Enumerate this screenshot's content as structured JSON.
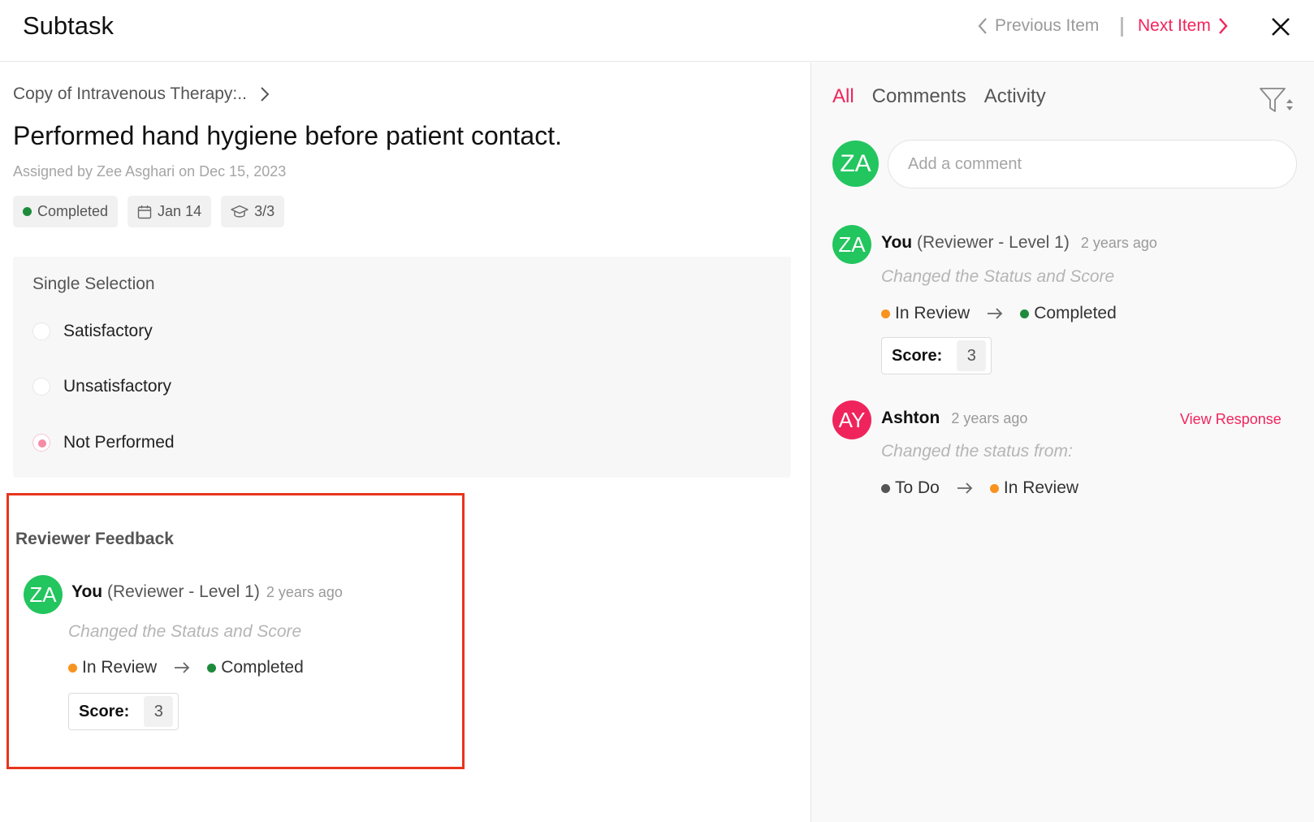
{
  "header": {
    "title": "Subtask",
    "prev_label": "Previous Item",
    "next_label": "Next Item"
  },
  "task": {
    "breadcrumb": "Copy of Intravenous Therapy:..",
    "title": "Performed hand hygiene before patient contact.",
    "assigned_prefix": "Assigned by Zee Asghari on",
    "assigned_date": "Dec 15, 2023",
    "status_chip": "Completed",
    "date_chip": "Jan 14",
    "score_chip": "3/3"
  },
  "selection": {
    "title": "Single Selection",
    "options": [
      {
        "label": "Satisfactory",
        "checked": false
      },
      {
        "label": "Unsatisfactory",
        "checked": false
      },
      {
        "label": "Not Performed",
        "checked": true
      }
    ]
  },
  "feedback": {
    "title": "Reviewer Feedback",
    "avatar": "ZA",
    "name": "You",
    "role": "(Reviewer - Level 1)",
    "time": "2 years ago",
    "action": "Changed the Status and Score",
    "from_status": "In Review",
    "to_status": "Completed",
    "score_label": "Score:",
    "score_value": "3"
  },
  "activity": {
    "tabs": [
      "All",
      "Comments",
      "Activity"
    ],
    "active_tab": "All",
    "my_avatar": "ZA",
    "comment_placeholder": "Add a comment",
    "entries": [
      {
        "avatar": "ZA",
        "name": "You",
        "role": "(Reviewer - Level 1)",
        "time": "2 years ago",
        "action": "Changed the Status and Score",
        "from_status": "In Review",
        "to_status": "Completed",
        "score_label": "Score:",
        "score_value": "3"
      },
      {
        "avatar": "AY",
        "name": "Ashton",
        "time": "2 years ago",
        "link": "View Response",
        "action": "Changed the status from:",
        "from_status": "To Do",
        "to_status": "In Review"
      }
    ]
  },
  "colors": {
    "accent": "#f0245c",
    "green": "#1e8a3c",
    "orange": "#f7931e",
    "avatar_green": "#22c55e"
  },
  "icons": [
    "chevron-left-icon",
    "chevron-right-icon",
    "close-icon",
    "calendar-icon",
    "graduation-cap-icon",
    "filter-icon",
    "arrow-right-icon"
  ]
}
